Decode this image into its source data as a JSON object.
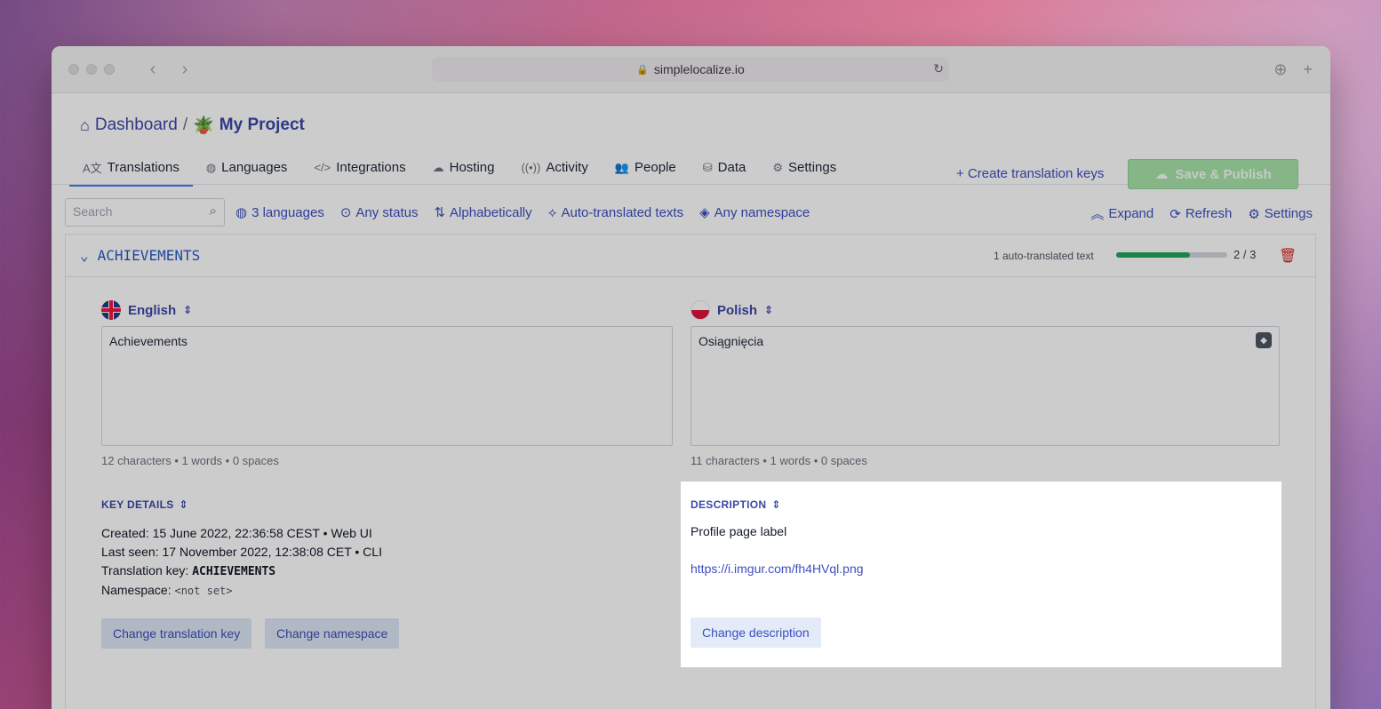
{
  "browser": {
    "url": "simplelocalize.io"
  },
  "header": {
    "breadcrumb_root": "Dashboard",
    "breadcrumb_sep": "/",
    "project_emoji": "🪴",
    "project_name": "My Project",
    "create_keys_label": "Create translation keys",
    "save_publish_label": "Save & Publish"
  },
  "tabs": [
    {
      "label": "Translations",
      "icon": "translate-icon"
    },
    {
      "label": "Languages",
      "icon": "globe-icon"
    },
    {
      "label": "Integrations",
      "icon": "code-icon"
    },
    {
      "label": "Hosting",
      "icon": "cloud-icon"
    },
    {
      "label": "Activity",
      "icon": "broadcast-icon"
    },
    {
      "label": "People",
      "icon": "people-icon"
    },
    {
      "label": "Data",
      "icon": "database-icon"
    },
    {
      "label": "Settings",
      "icon": "gear-icon"
    }
  ],
  "filters": {
    "search_placeholder": "Search",
    "languages": "3 languages",
    "status": "Any status",
    "sort": "Alphabetically",
    "auto_translated": "Auto-translated texts",
    "namespace": "Any namespace",
    "expand": "Expand",
    "refresh": "Refresh",
    "settings": "Settings"
  },
  "key": {
    "name": "ACHIEVEMENTS",
    "auto_translated_text": "1 auto-translated text",
    "progress": 0.667,
    "count": "2 / 3",
    "english": {
      "label": "English",
      "value": "Achievements",
      "stats": "12 characters • 1 words • 0 spaces"
    },
    "polish": {
      "label": "Polish",
      "value": "Osiągnięcia",
      "stats": "11 characters • 1 words • 0 spaces"
    },
    "details": {
      "label": "KEY DETAILS",
      "created_label": "Created:",
      "created_value": "15 June 2022, 22:36:58 CEST • Web UI",
      "last_seen_label": "Last seen:",
      "last_seen_value": "17 November 2022, 12:38:08 CET • CLI",
      "key_label": "Translation key:",
      "key_value": "ACHIEVEMENTS",
      "namespace_label": "Namespace:",
      "namespace_value": "<not set>",
      "change_key_button": "Change translation key",
      "change_namespace_button": "Change namespace"
    },
    "description": {
      "label": "DESCRIPTION",
      "text": "Profile page label",
      "link": "https://i.imgur.com/fh4HVql.png",
      "change_button": "Change description"
    }
  }
}
